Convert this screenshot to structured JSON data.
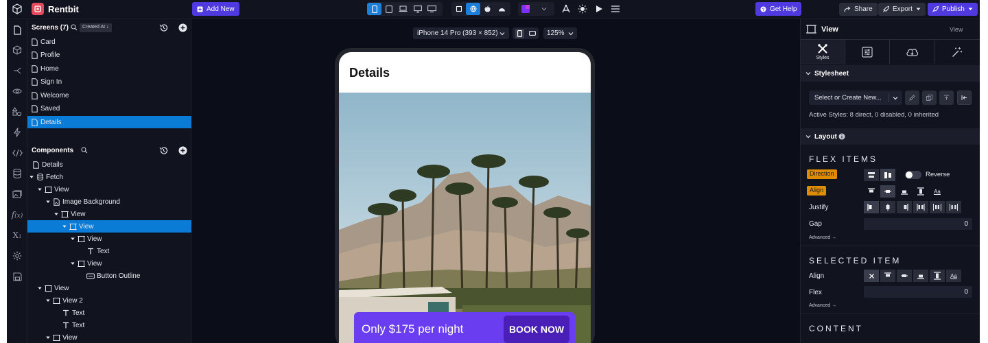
{
  "app": {
    "title": "Rentbit"
  },
  "topbar": {
    "add_new": "Add New",
    "get_help": "Get Help",
    "share": "Share",
    "export": "Export",
    "publish": "Publish"
  },
  "screens": {
    "title": "Screens (7)",
    "sort_label": "Created At ↓",
    "items": [
      {
        "label": "Card"
      },
      {
        "label": "Profile"
      },
      {
        "label": "Home"
      },
      {
        "label": "Sign In"
      },
      {
        "label": "Welcome"
      },
      {
        "label": "Saved"
      },
      {
        "label": "Details",
        "selected": true
      }
    ]
  },
  "components": {
    "title": "Components",
    "tree": [
      {
        "label": "Details",
        "icon": "page-icon"
      },
      {
        "label": "Fetch",
        "icon": "database-icon"
      },
      {
        "label": "View",
        "icon": "view-icon"
      },
      {
        "label": "Image Background",
        "icon": "image-file-icon"
      },
      {
        "label": "View",
        "icon": "view-icon"
      },
      {
        "label": "View",
        "icon": "view-icon",
        "selected": true
      },
      {
        "label": "View",
        "icon": "view-icon"
      },
      {
        "label": "Text",
        "icon": "text-icon"
      },
      {
        "label": "View",
        "icon": "view-icon"
      },
      {
        "label": "Button Outline",
        "icon": "button-icon"
      },
      {
        "label": "View",
        "icon": "view-icon"
      },
      {
        "label": "View 2",
        "icon": "view-icon"
      },
      {
        "label": "Text",
        "icon": "text-icon"
      },
      {
        "label": "Text",
        "icon": "text-icon"
      },
      {
        "label": "View",
        "icon": "view-icon"
      }
    ]
  },
  "canvas": {
    "device": "iPhone 14 Pro (393 × 852)",
    "zoom": "125%",
    "screen": {
      "title": "Details",
      "price_text": "Only $175 per night",
      "cta_label": "BOOK NOW"
    }
  },
  "inspector": {
    "component_name": "View",
    "view_label": "View",
    "tabs": [
      {
        "label": "Styles"
      }
    ],
    "stylesheet": {
      "title": "Stylesheet",
      "select_placeholder": "Select or Create New...",
      "active_styles": "Active Styles: 8 direct, 0 disabled, 0 inherited"
    },
    "layout": {
      "title": "Layout",
      "flex_items_heading": "FLEX ITEMS",
      "direction_label": "Direction",
      "reverse_label": "Reverse",
      "align_label": "Align",
      "justify_label": "Justify",
      "gap_label": "Gap",
      "gap_value": "0",
      "advanced": "Advanced →"
    },
    "selected_item": {
      "heading": "SELECTED ITEM",
      "align_label": "Align",
      "flex_label": "Flex",
      "flex_value": "0",
      "advanced": "Advanced →"
    },
    "content": {
      "heading": "CONTENT"
    }
  },
  "colors": {
    "accent_blue": "#0a7cd6",
    "purple": "#4f3ae0",
    "cta_purple": "#6b3df0",
    "tag_orange": "#e08c00",
    "background": "#0b0d18"
  }
}
